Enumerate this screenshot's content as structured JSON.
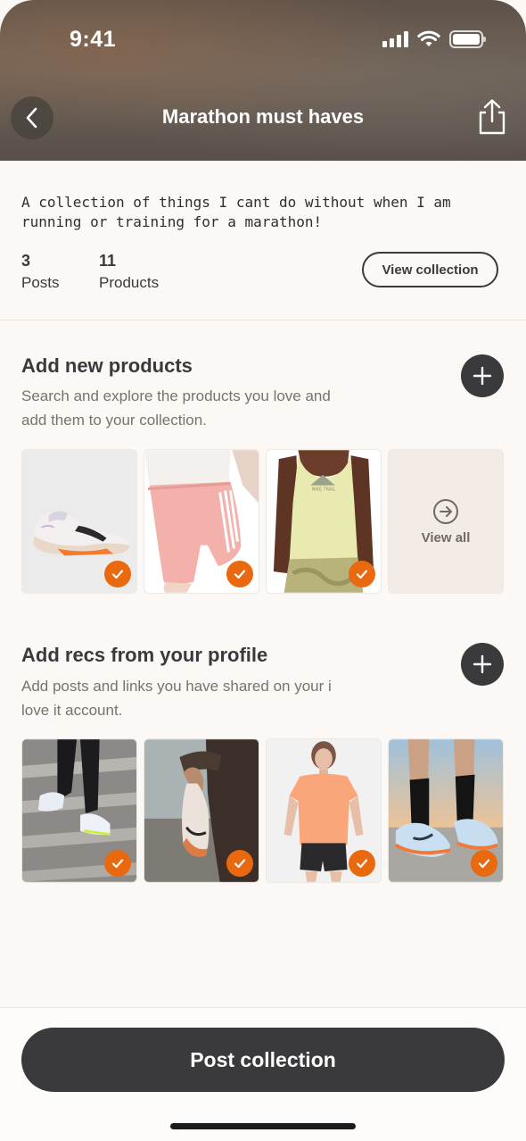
{
  "status": {
    "time": "9:41"
  },
  "header": {
    "title": "Marathon must haves",
    "back_icon": "chevron-left-icon",
    "share_icon": "share-icon"
  },
  "collection": {
    "description": "A collection of things I cant do without when I am running or training for a marathon!",
    "posts_count": "3",
    "posts_label": "Posts",
    "products_count": "11",
    "products_label": "Products",
    "view_collection_label": "View collection"
  },
  "products_section": {
    "title": "Add new products",
    "subtitle": "Search and explore the products you love and add them to your collection.",
    "items": [
      {
        "kind": "running shoe",
        "selected": true
      },
      {
        "kind": "pink running shorts",
        "selected": true
      },
      {
        "kind": "yellow running tank",
        "selected": true
      }
    ],
    "view_all_label": "View all"
  },
  "recs_section": {
    "title": "Add recs from your profile",
    "subtitle": "Add posts and links you have shared on your i love it account.",
    "items": [
      {
        "kind": "runner on stairs",
        "selected": true
      },
      {
        "kind": "holding running shoe",
        "selected": true
      },
      {
        "kind": "orange running tee",
        "selected": true
      },
      {
        "kind": "shoes on track",
        "selected": true
      }
    ]
  },
  "footer": {
    "post_label": "Post collection"
  },
  "colors": {
    "accent": "#e8690f",
    "dark": "#3a3a3d",
    "background": "#fbf8f5"
  }
}
